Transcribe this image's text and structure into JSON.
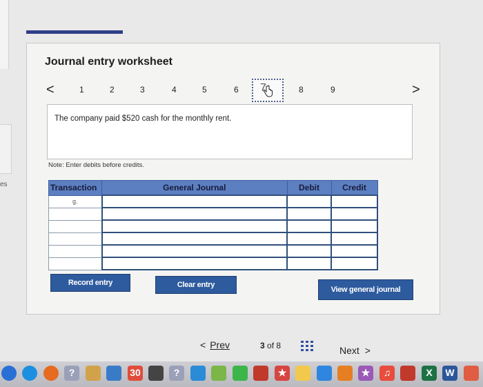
{
  "side": {
    "label": "es"
  },
  "worksheet": {
    "title": "Journal entry worksheet",
    "pager": {
      "prev_glyph": "<",
      "next_glyph": ">",
      "pages": [
        "1",
        "2",
        "3",
        "4",
        "5",
        "6",
        "7",
        "8",
        "9"
      ],
      "current": "7"
    },
    "description": "The company paid $520 cash for the monthly rent.",
    "note": "Note: Enter debits before credits."
  },
  "journal": {
    "headers": {
      "transaction": "Transaction",
      "general_journal": "General Journal",
      "debit": "Debit",
      "credit": "Credit"
    },
    "rows": [
      {
        "transaction": "g.",
        "account": "",
        "debit": "",
        "credit": ""
      },
      {
        "transaction": "",
        "account": "",
        "debit": "",
        "credit": ""
      },
      {
        "transaction": "",
        "account": "",
        "debit": "",
        "credit": ""
      },
      {
        "transaction": "",
        "account": "",
        "debit": "",
        "credit": ""
      },
      {
        "transaction": "",
        "account": "",
        "debit": "",
        "credit": ""
      },
      {
        "transaction": "",
        "account": "",
        "debit": "",
        "credit": ""
      }
    ]
  },
  "buttons": {
    "record": "Record entry",
    "clear": "Clear entry",
    "view": "View general journal"
  },
  "navigation": {
    "prev_label": "Prev",
    "prev_glyph": "<",
    "position": "3",
    "of_label": "of",
    "total": "8",
    "next_label": "Next",
    "next_glyph": ">"
  },
  "taskbar": {
    "icons": [
      {
        "name": "finder-icon",
        "color": "#2a6fd6",
        "glyph": ""
      },
      {
        "name": "safari-icon",
        "color": "#1d8fe0",
        "glyph": ""
      },
      {
        "name": "firefox-icon",
        "color": "#e66a1f",
        "glyph": ""
      },
      {
        "name": "help-icon",
        "color": "#9aa0b8",
        "glyph": "?"
      },
      {
        "name": "app-icon",
        "color": "#d2a24a",
        "glyph": ""
      },
      {
        "name": "preview-icon",
        "color": "#3a7bc8",
        "glyph": ""
      },
      {
        "name": "calendar-icon",
        "color": "#e04b3c",
        "glyph": "30"
      },
      {
        "name": "notes-icon",
        "color": "#444",
        "glyph": ""
      },
      {
        "name": "help-icon-2",
        "color": "#9aa0b8",
        "glyph": "?"
      },
      {
        "name": "app-icon-2",
        "color": "#2c8bd6",
        "glyph": ""
      },
      {
        "name": "photos-icon",
        "color": "#7ab648",
        "glyph": ""
      },
      {
        "name": "facetime-icon",
        "color": "#3cb54a",
        "glyph": ""
      },
      {
        "name": "photo-booth-icon",
        "color": "#c0392b",
        "glyph": ""
      },
      {
        "name": "star-icon",
        "color": "#d64541",
        "glyph": "★"
      },
      {
        "name": "stickies-icon",
        "color": "#f2c94c",
        "glyph": ""
      },
      {
        "name": "app-icon-3",
        "color": "#2e86de",
        "glyph": ""
      },
      {
        "name": "photos-app-icon",
        "color": "#e67e22",
        "glyph": ""
      },
      {
        "name": "star-icon-2",
        "color": "#9b59b6",
        "glyph": "★"
      },
      {
        "name": "music-icon",
        "color": "#e74c3c",
        "glyph": "♫"
      },
      {
        "name": "app-icon-4",
        "color": "#c0392b",
        "glyph": ""
      },
      {
        "name": "excel-icon",
        "color": "#1e7145",
        "glyph": "X"
      },
      {
        "name": "word-icon",
        "color": "#2b579a",
        "glyph": "W"
      },
      {
        "name": "app-icon-5",
        "color": "#e05d44",
        "glyph": ""
      }
    ]
  }
}
